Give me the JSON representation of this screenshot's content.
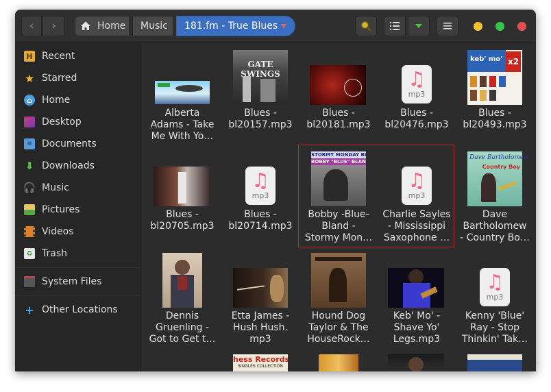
{
  "header": {
    "back": "‹",
    "forward": "›",
    "breadcrumbs": [
      "Home",
      "Music",
      "181.fm - True Blues"
    ],
    "colors": {
      "accent": "#3a6fc2",
      "close": "#e64c4c",
      "maximize": "#36c64a",
      "minimize": "#f5c12d"
    },
    "icons": [
      "search-icon",
      "list-view-icon",
      "view-options-icon",
      "menu-icon"
    ]
  },
  "sidebar": {
    "items": [
      {
        "label": "Recent",
        "icon": "recent-icon"
      },
      {
        "label": "Starred",
        "icon": "star-icon"
      },
      {
        "label": "Home",
        "icon": "home-icon"
      },
      {
        "label": "Desktop",
        "icon": "desktop-icon"
      },
      {
        "label": "Documents",
        "icon": "documents-icon"
      },
      {
        "label": "Downloads",
        "icon": "downloads-icon"
      },
      {
        "label": "Music",
        "icon": "music-icon"
      },
      {
        "label": "Pictures",
        "icon": "pictures-icon"
      },
      {
        "label": "Videos",
        "icon": "videos-icon"
      },
      {
        "label": "Trash",
        "icon": "trash-icon"
      },
      {
        "label": "System Files",
        "icon": "drive-icon"
      },
      {
        "label": "Other Locations",
        "icon": "plus-icon"
      }
    ]
  },
  "files": [
    {
      "l1": "Alberta",
      "l2": "Adams - Take",
      "l3": "Me With Yo…"
    },
    {
      "l1": "Blues -",
      "l2": "bl20157.mp3",
      "l3": "",
      "art_text": "GATE SWINGS"
    },
    {
      "l1": "Blues -",
      "l2": "bl20181.mp3",
      "l3": ""
    },
    {
      "l1": "Blues -",
      "l2": "bl20476.mp3",
      "l3": ""
    },
    {
      "l1": "Blues -",
      "l2": "bl20493.mp3",
      "l3": "",
      "art_text": "keb' mo'",
      "art_text2": "x2"
    },
    {
      "l1": "Blues -",
      "l2": "bl20705.mp3",
      "l3": ""
    },
    {
      "l1": "Blues -",
      "l2": "bl20714.mp3",
      "l3": ""
    },
    {
      "l1": "Bobby -Blue-",
      "l2": "Bland -",
      "l3": "Stormy Mon…",
      "art_text": "STORMY MONDAY BLUES",
      "art_text2": "BOBBY \"BLUE\" BLAND"
    },
    {
      "l1": "Charlie Sayles",
      "l2": "- Mississippi",
      "l3": "Saxophone …"
    },
    {
      "l1": "Dave",
      "l2": "Bartholomew",
      "l3": "- Country Bo…",
      "art_text": "Dave Bartholomew",
      "art_text2": "Country Boy"
    },
    {
      "l1": "Dennis",
      "l2": "Gruenling -",
      "l3": "Got to Get t…"
    },
    {
      "l1": "Etta James -",
      "l2": "Hush Hush.",
      "l3": "mp3"
    },
    {
      "l1": "Hound Dog",
      "l2": "Taylor & The",
      "l3": "HouseRock…"
    },
    {
      "l1": "Keb' Mo' -",
      "l2": "Shave Yo'",
      "l3": "Legs.mp3"
    },
    {
      "l1": "Kenny 'Blue'",
      "l2": "Ray - Stop",
      "l3": "Thinkin' Tak…"
    },
    {
      "l1": "",
      "l2": "",
      "l3": "",
      "art_text": "hess Records",
      "art_text2": "SINGLES COLLECTION"
    }
  ],
  "mp3": {
    "ext": "mp3",
    "note": "♫"
  }
}
